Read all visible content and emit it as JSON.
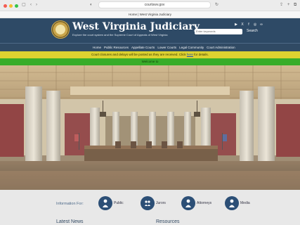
{
  "browser": {
    "url": "courtswv.gov",
    "tab_title": "Home | West Virginia Judiciary"
  },
  "header": {
    "title": "West Virginia Judiciary",
    "tagline": "Explore the court system and the Supreme Court of Appeals of West Virginia",
    "search_placeholder": "Enter keywords",
    "search_button": "Search"
  },
  "nav": {
    "items": [
      "Home",
      "Public Resources",
      "Appellate Courts",
      "Lower Courts",
      "Legal Community",
      "Court Administration"
    ]
  },
  "alerts": {
    "closure_text": "Court closures and delays will be posted as they are received. Click",
    "closure_link": "here",
    "closure_suffix": "for details.",
    "welcome_text": "Welcome to"
  },
  "info": {
    "label": "Information For:",
    "items": [
      "Public",
      "Jurors",
      "Attorneys",
      "Media"
    ]
  },
  "sections": {
    "latest_news": "Latest News",
    "resources": "Resources"
  },
  "colors": {
    "header": "#2e4a66",
    "closure_banner": "#ddd230",
    "welcome_banner": "#39ad29",
    "circle": "#2c4f76"
  }
}
